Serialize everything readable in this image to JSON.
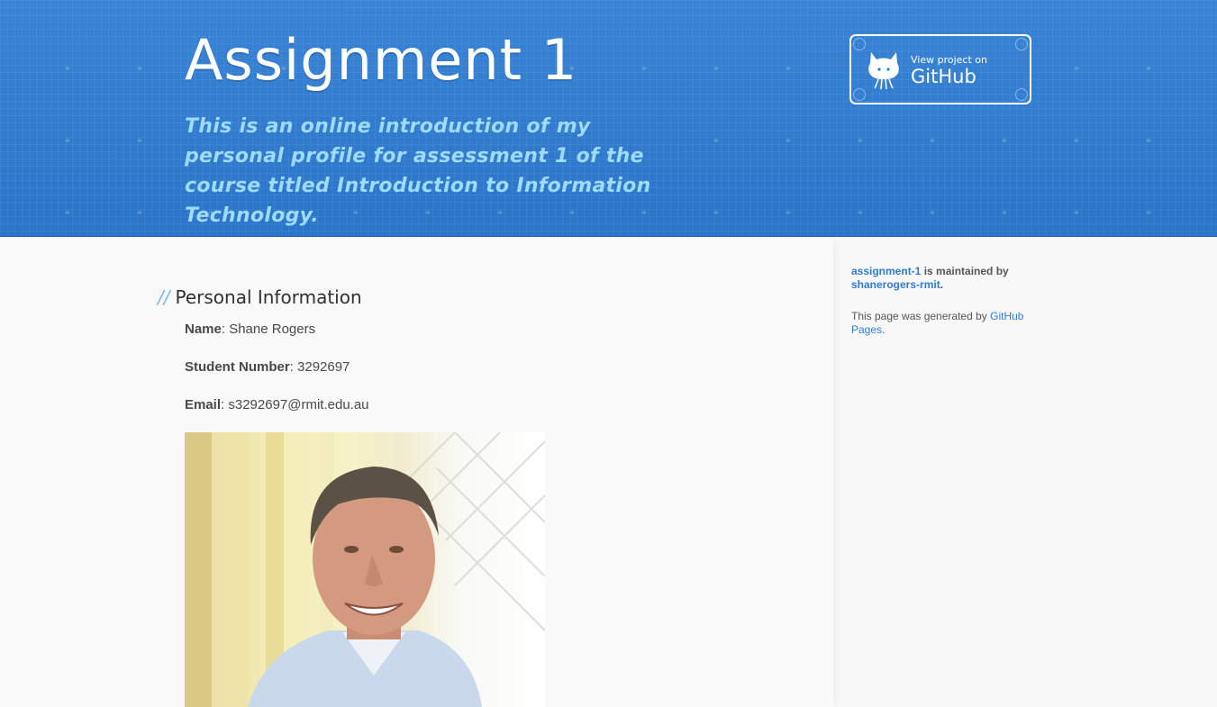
{
  "header": {
    "title": "Assignment 1",
    "tagline": "This is an online introduction of my personal profile for assessment 1 of the course titled Introduction to Information Technology.",
    "github_button": {
      "small_label": "View project on",
      "big_label": "GitHub",
      "icon": "octocat-icon"
    }
  },
  "main": {
    "section_heading_prefix": "//",
    "section_heading": "Personal Information",
    "fields": [
      {
        "label": "Name",
        "value": ": Shane Rogers"
      },
      {
        "label": "Student Number",
        "value": ": 3292697"
      },
      {
        "label": "Email",
        "value": ": s3292697@rmit.edu.au"
      }
    ],
    "photo": "profile-photo"
  },
  "sidebar": {
    "repo_link": "assignment-1",
    "maintained_text": " is maintained by ",
    "owner_link": "shanerogers-rmit",
    "owner_suffix": ".",
    "generated_text": "This page was generated by ",
    "generated_link": "GitHub Pages",
    "generated_suffix": "."
  },
  "colors": {
    "header_bg": "#2e7bcf",
    "tagline": "#9ddcff",
    "link": "#2e7bcf",
    "heading_accent": "#7ab8e8"
  }
}
